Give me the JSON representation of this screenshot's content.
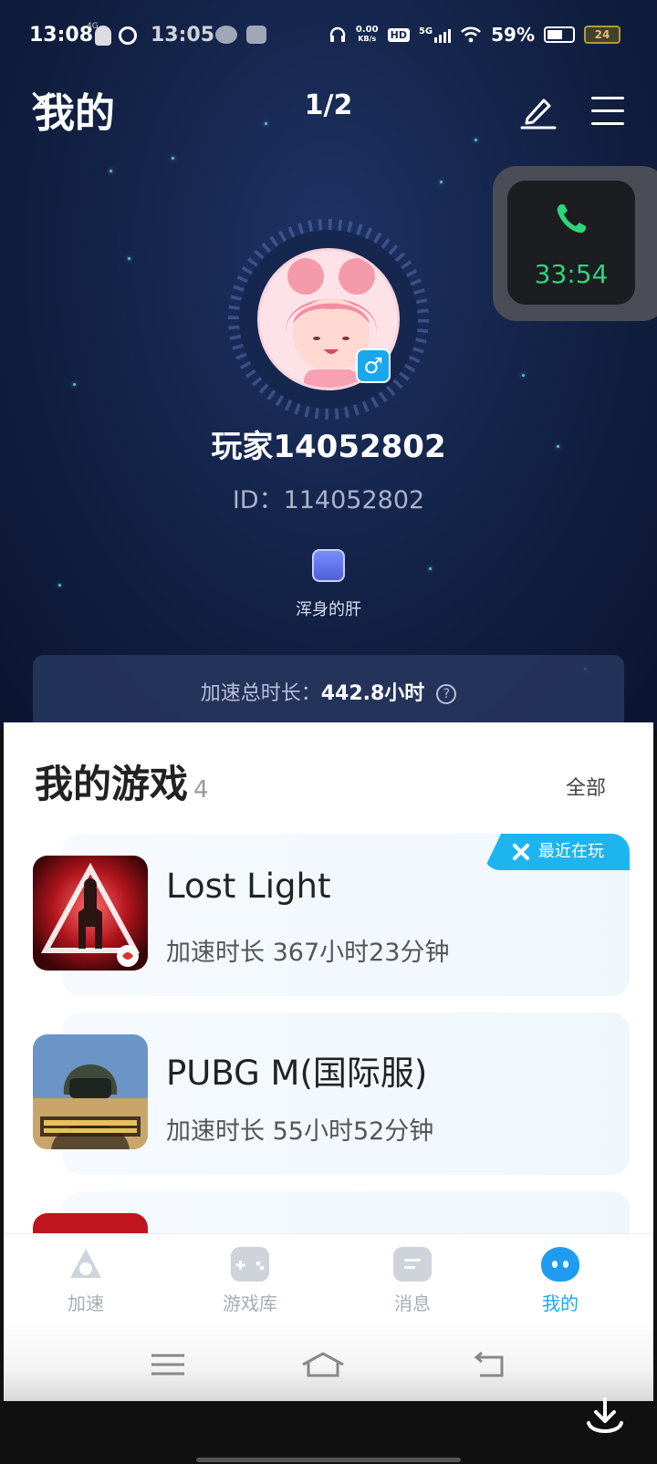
{
  "status_bar": {
    "time": "13:08",
    "time_secondary": "13:05",
    "net_speed_value": "0.00",
    "net_speed_unit": "KB/s",
    "hd_badge": "HD",
    "network": "5G",
    "battery_percent": "59%",
    "battery2_level": "24",
    "mini_4g_label": "4G"
  },
  "header": {
    "title": "我的",
    "page_indicator": "1/2"
  },
  "call_float": {
    "duration": "33:54"
  },
  "profile": {
    "gender_symbol": "♂",
    "username": "玩家14052802",
    "user_id": "ID：114052802",
    "medal_label": "浑身的肝",
    "total_label": "加速总时长：",
    "total_value": "442.8小时",
    "help_symbol": "?"
  },
  "my_games": {
    "title": "我的游戏",
    "count": "4",
    "all_link": "全部",
    "games": [
      {
        "name": "Lost Light",
        "time": "加速时长  367小时23分钟",
        "recent_tag": "最近在玩"
      },
      {
        "name": "PUBG M(国际服)",
        "time": "加速时长  55小时52分钟"
      }
    ]
  },
  "bottom_nav": {
    "items": [
      {
        "label": "加速"
      },
      {
        "label": "游戏库"
      },
      {
        "label": "消息"
      },
      {
        "label": "我的"
      }
    ]
  },
  "colors": {
    "accent": "#1da7ee",
    "call_green": "#2ed37a",
    "hero_bg": "#16274f"
  }
}
